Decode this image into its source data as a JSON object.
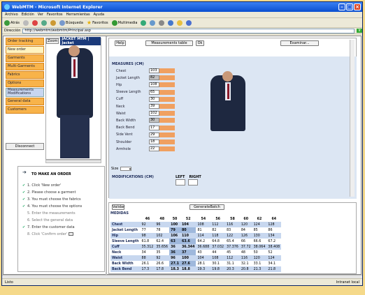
{
  "window": {
    "title": "WebMTM - Microsoft Internet Explorer"
  },
  "menu": [
    "Archivo",
    "Edición",
    "Ver",
    "Favoritos",
    "Herramientas",
    "Ayuda"
  ],
  "toolbar": {
    "back": "Atrás",
    "search": "Búsqueda",
    "favorites": "Favoritos",
    "multimedia": "Multimedia"
  },
  "address": {
    "label": "Dirección",
    "url": "http://webmtm/webmtm/Principal.asp",
    "go": "Ir"
  },
  "nav": [
    "Order tracking",
    "New order",
    "Garments",
    "Multi-Garments",
    "Fabrics",
    "Options",
    "Measurements Modifications",
    "General data",
    "Customers"
  ],
  "left": {
    "zoom": "Zoom",
    "jacket_title": "JACKET MTM | Jacket",
    "disconnect": "Disconnect"
  },
  "steps": {
    "title": "TO MAKE AN ORDER",
    "items": [
      "1. Click 'New order'",
      "2. Please choose a garment",
      "3. You must choose the fabrics",
      "4. You must choose the options",
      "5. Enter the measurements",
      "6. Select the general data",
      "7. Enter the customer data",
      "8. Click 'Confirm order'"
    ],
    "done": [
      true,
      true,
      true,
      true,
      false,
      false,
      true,
      false
    ]
  },
  "top_buttons": {
    "help": "Help",
    "table": "Measurements table",
    "ok": "Ok",
    "examine": "Examinar..."
  },
  "measures": {
    "title": "MEASURES (CM)",
    "rows": [
      {
        "label": "Chest",
        "value": "103",
        "grey": false
      },
      {
        "label": "Jacket Length",
        "value": "82",
        "grey": true
      },
      {
        "label": "Hip",
        "value": "108",
        "grey": false
      },
      {
        "label": "Sleeve Length",
        "value": "65",
        "grey": false
      },
      {
        "label": "Cuff",
        "value": "30",
        "grey": false
      },
      {
        "label": "Neck",
        "value": "39",
        "grey": false
      },
      {
        "label": "Waist",
        "value": "102",
        "grey": false
      },
      {
        "label": "Back Width",
        "value": "30",
        "grey": true
      },
      {
        "label": "Back Bend",
        "value": "17",
        "grey": false
      },
      {
        "label": "Side Vent",
        "value": "29",
        "grey": false
      },
      {
        "label": "Shoulder",
        "value": "18",
        "grey": false
      },
      {
        "label": "Armhole",
        "value": "22",
        "grey": false
      }
    ],
    "size_label": "Size",
    "modifications": "MODIFICATIONS (CM)",
    "left": "LEFT",
    "right": "RIGHT"
  },
  "bottom": {
    "validate": "Validar",
    "generate": "GenerateBatch",
    "title": "MEDIDAS"
  },
  "table": {
    "sizes": [
      "46",
      "48",
      "50",
      "52",
      "54",
      "56",
      "58",
      "60",
      "62",
      "64"
    ],
    "rows": [
      {
        "name": "Chest",
        "values": [
          "92",
          "96",
          "100",
          "104",
          "108",
          "112",
          "116",
          "120",
          "124",
          "128"
        ]
      },
      {
        "name": "Jacket Length",
        "values": [
          "77",
          "78",
          "79",
          "80",
          "81",
          "82",
          "83",
          "84",
          "85",
          "86"
        ]
      },
      {
        "name": "Hip",
        "values": [
          "98",
          "102",
          "106",
          "110",
          "114",
          "118",
          "122",
          "126",
          "130",
          "134"
        ]
      },
      {
        "name": "Sleeve Length",
        "values": [
          "61.8",
          "62.4",
          "63",
          "63.6",
          "64.2",
          "64.8",
          "65.4",
          "66",
          "66.6",
          "67.2"
        ]
      },
      {
        "name": "Cuff",
        "values": [
          "35.312",
          "35.656",
          "36",
          "36.344",
          "36.688",
          "37.032",
          "37.376",
          "37.72",
          "38.064",
          "38.408"
        ]
      },
      {
        "name": "Neck",
        "values": [
          "34",
          "35",
          "36",
          "37",
          "43",
          "44",
          "45",
          "48",
          "50",
          "52"
        ]
      },
      {
        "name": "Waist",
        "values": [
          "88",
          "92",
          "96",
          "100",
          "104",
          "108",
          "112",
          "116",
          "120",
          "124"
        ]
      },
      {
        "name": "Back Width",
        "values": [
          "26.1",
          "26.6",
          "27.1",
          "27.6",
          "28.1",
          "30.1",
          "31.1",
          "32.1",
          "33.1",
          "34.1"
        ]
      },
      {
        "name": "Back Bend",
        "values": [
          "17.3",
          "17.8",
          "18.3",
          "18.8",
          "19.3",
          "19.8",
          "20.3",
          "20.8",
          "21.3",
          "21.8"
        ]
      }
    ]
  },
  "status": {
    "left": "Listo",
    "right": "Intranet local"
  }
}
